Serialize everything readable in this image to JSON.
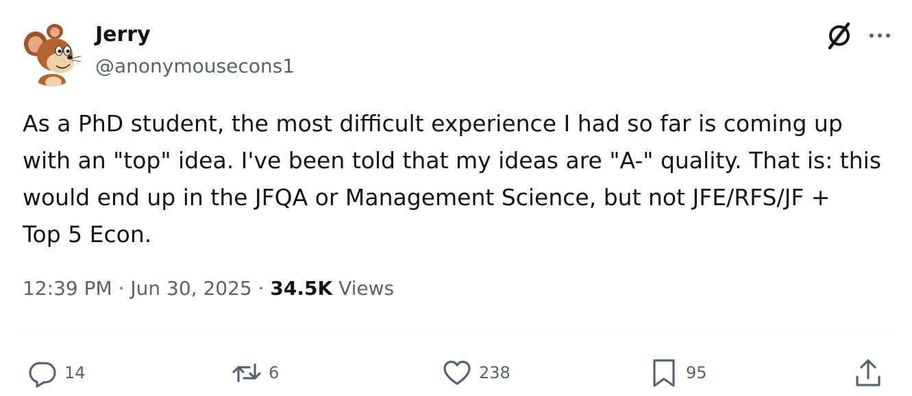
{
  "author": {
    "display_name": "Jerry",
    "handle": "@anonymousecons1",
    "avatar_icon": "jerry-mouse-avatar"
  },
  "header_actions": {
    "grok_icon": "grok-icon",
    "more_icon": "more-icon"
  },
  "post": {
    "text": "As a PhD student, the most difficult experience I had so far is coming up\nwith an \"top\" idea. I've been told that my ideas are \"A-\" quality. That is: this\nwould end up in the JFQA or Management Science, but not JFE/RFS/JF +\nTop 5 Econ."
  },
  "meta": {
    "time": "12:39 PM",
    "separator": "·",
    "date": "Jun 30, 2025",
    "views_count": "34.5K",
    "views_label": "Views"
  },
  "actions": {
    "reply": {
      "icon": "reply-icon",
      "count": "14"
    },
    "repost": {
      "icon": "repost-icon",
      "count": "6"
    },
    "like": {
      "icon": "heart-icon",
      "count": "238"
    },
    "bookmark": {
      "icon": "bookmark-icon",
      "count": "95"
    },
    "share": {
      "icon": "share-icon"
    }
  },
  "colors": {
    "text_primary": "#0f1419",
    "text_secondary": "#536471",
    "divider": "#eff3f4"
  }
}
